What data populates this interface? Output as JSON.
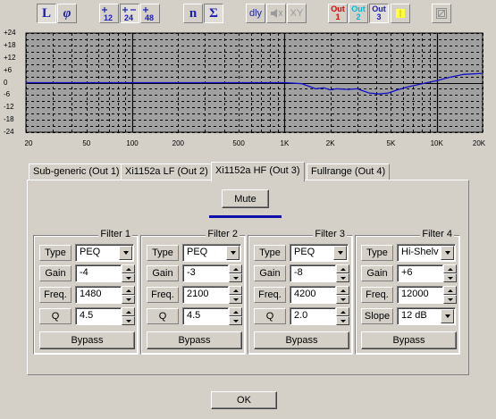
{
  "toolbar": {
    "lin_label": "L",
    "phase_label": "φ",
    "res12_label": "12",
    "res24_label": "24",
    "res48_label": "48",
    "n_label": "n",
    "sigma_label": "Σ",
    "dly_label": "dly",
    "xy_label": "XY",
    "out_word": "Out",
    "out1": "1",
    "out2": "2",
    "out3": "3",
    "out1_color": "#e00000",
    "out2_color": "#00b8d8",
    "out3_color": "#1c1cb4",
    "marker_color": "#ffff40"
  },
  "chart_data": {
    "type": "line",
    "title": "",
    "xlabel": "",
    "ylabel": "",
    "xscale": "log",
    "xlim": [
      20,
      20000
    ],
    "ylim": [
      -24,
      24
    ],
    "grid": true,
    "y_ticks": [
      "+24",
      "+21",
      "+18",
      "+15",
      "+12",
      "+9",
      "+6",
      "+3",
      "0",
      "-3",
      "-6",
      "-9",
      "-12",
      "-15",
      "-18",
      "-21",
      "-24"
    ],
    "y_tick_values": [
      24,
      21,
      18,
      15,
      12,
      9,
      6,
      3,
      0,
      -3,
      -6,
      -9,
      -12,
      -15,
      -18,
      -21,
      -24
    ],
    "y_labels_shown": [
      "+24",
      "+18",
      "+12",
      "+6",
      "0",
      "-6",
      "-12",
      "-18",
      "-24"
    ],
    "y_label_values": [
      24,
      18,
      12,
      6,
      0,
      -6,
      -12,
      -18,
      -24
    ],
    "x_ticks": [
      "20",
      "50",
      "100",
      "200",
      "500",
      "1K",
      "2K",
      "5K",
      "10K",
      "20K"
    ],
    "x_tick_values": [
      20,
      50,
      100,
      200,
      500,
      1000,
      2000,
      5000,
      10000,
      20000
    ],
    "series": [
      {
        "color": "#1010c8",
        "x": [
          20,
          100,
          500,
          1000,
          1300,
          1600,
          1800,
          2000,
          2200,
          2600,
          3000,
          3600,
          4200,
          4800,
          5500,
          6500,
          8000,
          10000,
          12000,
          15000,
          20000
        ],
        "y": [
          0,
          0,
          0,
          0,
          -0.5,
          -3,
          -2.5,
          -3.5,
          -3,
          -3.3,
          -3,
          -5,
          -5.5,
          -5,
          -3.5,
          -2,
          -0.5,
          1,
          2.5,
          4,
          4.5
        ]
      }
    ],
    "background": "#a0a0a0"
  },
  "tabs": [
    {
      "label": "Sub-generic (Out 1)"
    },
    {
      "label": "Xi1152a LF (Out 2)"
    },
    {
      "label": "Xi1152a HF (Out 3)"
    },
    {
      "label": "Fullrange (Out 4)"
    }
  ],
  "active_tab": 2,
  "panel": {
    "mute_label": "Mute",
    "mute_indicator_color": "#1010a8"
  },
  "filters": [
    {
      "title": "Filter 1",
      "type_label": "Type",
      "type": "PEQ",
      "gain_label": "Gain",
      "gain": "-4",
      "freq_label": "Freq.",
      "freq": "1480",
      "last_label": "Q",
      "last": "4.5",
      "last_is_combo": false,
      "bypass_label": "Bypass"
    },
    {
      "title": "Filter 2",
      "type_label": "Type",
      "type": "PEQ",
      "gain_label": "Gain",
      "gain": "-3",
      "freq_label": "Freq.",
      "freq": "2100",
      "last_label": "Q",
      "last": "4.5",
      "last_is_combo": false,
      "bypass_label": "Bypass"
    },
    {
      "title": "Filter 3",
      "type_label": "Type",
      "type": "PEQ",
      "gain_label": "Gain",
      "gain": "-8",
      "freq_label": "Freq.",
      "freq": "4200",
      "last_label": "Q",
      "last": "2.0",
      "last_is_combo": false,
      "bypass_label": "Bypass"
    },
    {
      "title": "Filter 4",
      "type_label": "Type",
      "type": "Hi-Shelv",
      "gain_label": "Gain",
      "gain": "+6",
      "freq_label": "Freq.",
      "freq": "12000",
      "last_label": "Slope",
      "last": "12 dB",
      "last_is_combo": true,
      "bypass_label": "Bypass"
    }
  ],
  "ok_label": "OK"
}
